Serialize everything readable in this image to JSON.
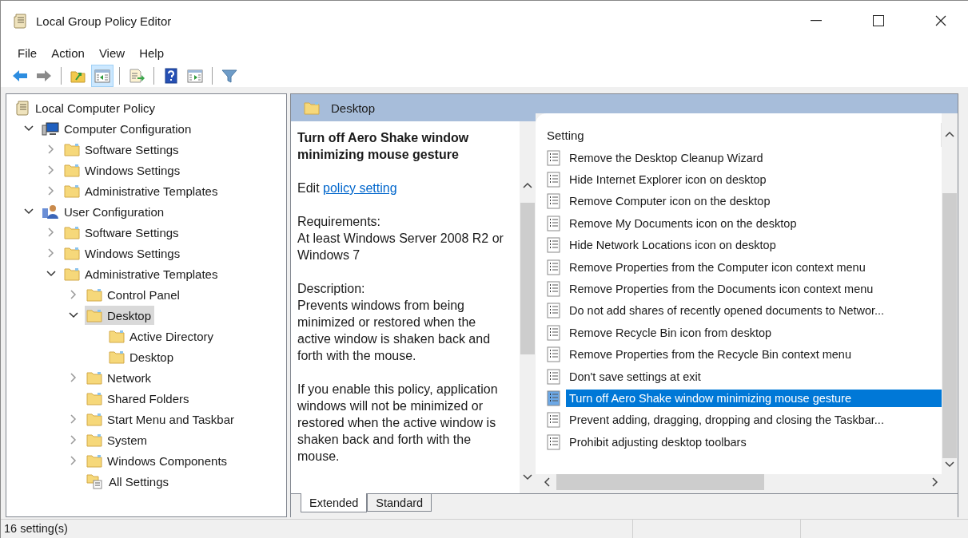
{
  "window": {
    "title": "Local Group Policy Editor"
  },
  "menu": [
    "File",
    "Action",
    "View",
    "Help"
  ],
  "toolbar": [
    [
      {
        "kind": "back",
        "pressed": false,
        "disabled": false
      },
      {
        "kind": "forward",
        "pressed": false,
        "disabled": true
      }
    ],
    [
      {
        "kind": "up",
        "pressed": false,
        "disabled": false
      },
      {
        "kind": "tree-toggle",
        "pressed": true,
        "disabled": false
      }
    ],
    [
      {
        "kind": "export",
        "pressed": false,
        "disabled": false
      }
    ],
    [
      {
        "kind": "help",
        "pressed": false,
        "disabled": false
      },
      {
        "kind": "pane-toggle",
        "pressed": false,
        "disabled": false
      }
    ],
    [
      {
        "kind": "filter",
        "pressed": false,
        "disabled": false
      }
    ]
  ],
  "tree": {
    "kind": "policy-root",
    "label": "Local Computer Policy",
    "selected": false,
    "children": [
      {
        "kind": "computer",
        "label": "Computer Configuration",
        "expandable": true,
        "expanded": true,
        "selected": false,
        "children": [
          {
            "kind": "folder",
            "label": "Software Settings",
            "expandable": true,
            "expanded": false,
            "selected": false
          },
          {
            "kind": "folder",
            "label": "Windows Settings",
            "expandable": true,
            "expanded": false,
            "selected": false
          },
          {
            "kind": "folder",
            "label": "Administrative Templates",
            "expandable": true,
            "expanded": false,
            "selected": false
          }
        ]
      },
      {
        "kind": "user",
        "label": "User Configuration",
        "expandable": true,
        "expanded": true,
        "selected": false,
        "children": [
          {
            "kind": "folder",
            "label": "Software Settings",
            "expandable": true,
            "expanded": false,
            "selected": false
          },
          {
            "kind": "folder",
            "label": "Windows Settings",
            "expandable": true,
            "expanded": false,
            "selected": false
          },
          {
            "kind": "folder",
            "label": "Administrative Templates",
            "expandable": true,
            "expanded": true,
            "selected": false,
            "children": [
              {
                "kind": "folder",
                "label": "Control Panel",
                "expandable": true,
                "expanded": false,
                "selected": false
              },
              {
                "kind": "folder",
                "label": "Desktop",
                "expandable": true,
                "expanded": true,
                "selected": true,
                "children": [
                  {
                    "kind": "folder",
                    "label": "Active Directory",
                    "expandable": false,
                    "selected": false
                  },
                  {
                    "kind": "folder",
                    "label": "Desktop",
                    "expandable": false,
                    "selected": false
                  }
                ]
              },
              {
                "kind": "folder",
                "label": "Network",
                "expandable": true,
                "expanded": false,
                "selected": false
              },
              {
                "kind": "folder",
                "label": "Shared Folders",
                "expandable": false,
                "selected": false
              },
              {
                "kind": "folder",
                "label": "Start Menu and Taskbar",
                "expandable": true,
                "expanded": false,
                "selected": false
              },
              {
                "kind": "folder",
                "label": "System",
                "expandable": true,
                "expanded": false,
                "selected": false
              },
              {
                "kind": "folder",
                "label": "Windows Components",
                "expandable": true,
                "expanded": false,
                "selected": false
              },
              {
                "kind": "all-settings",
                "label": "All Settings",
                "expandable": false,
                "selected": false
              }
            ]
          }
        ]
      }
    ]
  },
  "pane": {
    "header": "Desktop",
    "details": {
      "title": "Turn off Aero Shake window minimizing mouse gesture",
      "edit_prefix": "Edit",
      "edit_link": "policy setting",
      "requirements_label": "Requirements:",
      "requirements": "At least Windows Server 2008 R2 or Windows 7",
      "description_label": "Description:",
      "paragraphs": [
        "Prevents windows from being minimized or restored when the active window is shaken back and forth with the mouse.",
        "If you enable this policy, application windows will not be minimized or restored when the active window is shaken back and forth with the mouse."
      ]
    },
    "list": {
      "column": "Setting",
      "rows": [
        {
          "label": "Remove the Desktop Cleanup Wizard",
          "selected": false
        },
        {
          "label": "Hide Internet Explorer icon on desktop",
          "selected": false
        },
        {
          "label": "Remove Computer icon on the desktop",
          "selected": false
        },
        {
          "label": "Remove My Documents icon on the desktop",
          "selected": false
        },
        {
          "label": "Hide Network Locations icon on desktop",
          "selected": false
        },
        {
          "label": "Remove Properties from the Computer icon context menu",
          "selected": false
        },
        {
          "label": "Remove Properties from the Documents icon context menu",
          "selected": false
        },
        {
          "label": "Do not add shares of recently opened documents to Networ...",
          "selected": false
        },
        {
          "label": "Remove Recycle Bin icon from desktop",
          "selected": false
        },
        {
          "label": "Remove Properties from the Recycle Bin context menu",
          "selected": false
        },
        {
          "label": "Don't save settings at exit",
          "selected": false
        },
        {
          "label": "Turn off Aero Shake window minimizing mouse gesture",
          "selected": true
        },
        {
          "label": "Prevent adding, dragging, dropping and closing the Taskbar...",
          "selected": false
        },
        {
          "label": "Prohibit adjusting desktop toolbars",
          "selected": false
        }
      ]
    },
    "tabs": [
      {
        "label": "Extended",
        "selected": true
      },
      {
        "label": "Standard",
        "selected": false
      }
    ]
  },
  "status_bar": {
    "text": "16 setting(s)"
  }
}
